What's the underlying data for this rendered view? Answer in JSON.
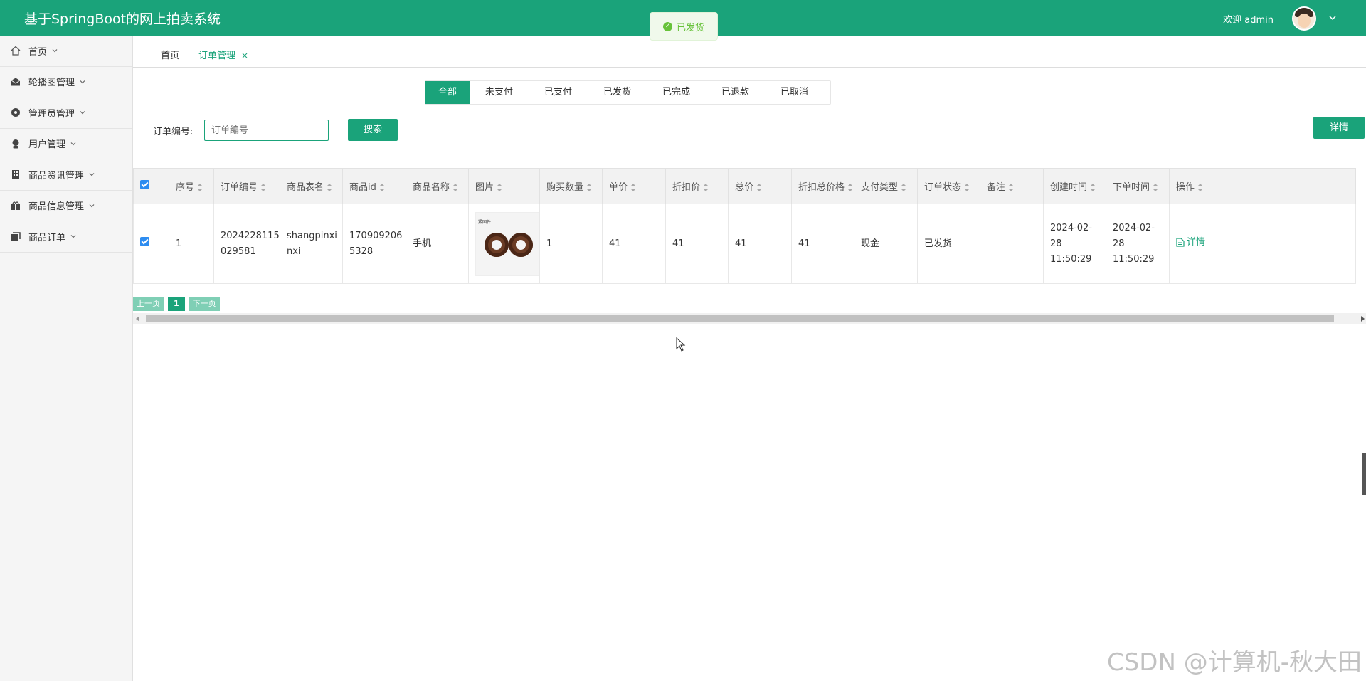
{
  "app": {
    "title": "基于SpringBoot的网上拍卖系统",
    "welcome": "欢迎 admin"
  },
  "toast": {
    "message": "已发货",
    "color": "#67c23a"
  },
  "theme": {
    "primary": "#1aa37a",
    "checkbox": "#2d8cf0"
  },
  "sidebar": {
    "items": [
      {
        "label": "首页",
        "icon": "home-icon"
      },
      {
        "label": "轮播图管理",
        "icon": "mail-icon"
      },
      {
        "label": "管理员管理",
        "icon": "circle-dot-icon"
      },
      {
        "label": "用户管理",
        "icon": "user-icon"
      },
      {
        "label": "商品资讯管理",
        "icon": "building-icon"
      },
      {
        "label": "商品信息管理",
        "icon": "gift-icon"
      },
      {
        "label": "商品订单",
        "icon": "folders-icon"
      }
    ]
  },
  "tabs": {
    "home": "首页",
    "active": "订单管理",
    "close": "×"
  },
  "status_tabs": [
    "全部",
    "未支付",
    "已支付",
    "已发货",
    "已完成",
    "已退款",
    "已取消"
  ],
  "search": {
    "label": "订单编号:",
    "placeholder": "订单编号",
    "button": "搜索",
    "detail_button": "详情"
  },
  "table": {
    "columns": [
      "序号",
      "订单编号",
      "商品表名",
      "商品id",
      "商品名称",
      "图片",
      "购买数量",
      "单价",
      "折扣价",
      "总价",
      "折扣总价格",
      "支付类型",
      "订单状态",
      "备注",
      "创建时间",
      "下单时间",
      "操作"
    ],
    "rows": [
      {
        "index": "1",
        "order_no": "2024228115029581",
        "table_name": "shangpinxinxi",
        "product_id": "1709092065328",
        "product_name": "手机",
        "image_label": "紧固件",
        "quantity": "1",
        "unit_price": "41",
        "discount_price": "41",
        "total": "41",
        "discount_total": "41",
        "pay_type": "现金",
        "status": "已发货",
        "remark": "",
        "created": "2024-02-28 11:50:29",
        "ordered": "2024-02-28 11:50:29",
        "action": "详情"
      }
    ]
  },
  "pager": {
    "prev": "上一页",
    "current": "1",
    "next": "下一页"
  },
  "watermark": "CSDN @计算机-秋大田"
}
